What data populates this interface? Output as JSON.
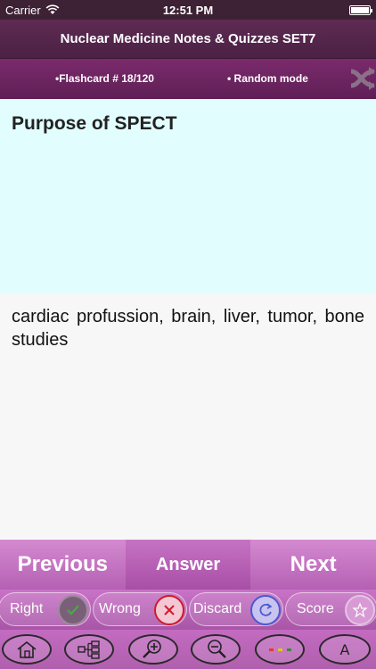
{
  "status": {
    "carrier": "Carrier",
    "time": "12:51 PM"
  },
  "header": {
    "title": "Nuclear Medicine Notes & Quizzes SET7"
  },
  "subheader": {
    "flashcard": "•Flashcard #  18/120",
    "mode": "• Random mode"
  },
  "card": {
    "question": "Purpose of SPECT",
    "answer": "cardiac profussion, brain, liver, tumor, bone studies"
  },
  "nav": {
    "previous": "Previous",
    "answer": "Answer",
    "next": "Next"
  },
  "marks": {
    "right": "Right",
    "wrong": "Wrong",
    "discard": "Discard",
    "score": "Score"
  },
  "toolbar": {
    "font_label": "A"
  },
  "icons": [
    "wifi-icon",
    "battery-icon",
    "shuffle-icon",
    "check-icon",
    "x-icon",
    "refresh-icon",
    "star-icon",
    "home-icon",
    "tree-icon",
    "zoom-in-icon",
    "zoom-out-icon",
    "color-dots-icon",
    "font-icon"
  ],
  "colors": {
    "header": "#5e2b53",
    "subheader": "#7b2a6c",
    "question_bg": "#e2fdfe",
    "nav": "#c874c6",
    "right": "#3a8a3a",
    "wrong": "#d11a2a",
    "discard": "#4a5ad0"
  }
}
